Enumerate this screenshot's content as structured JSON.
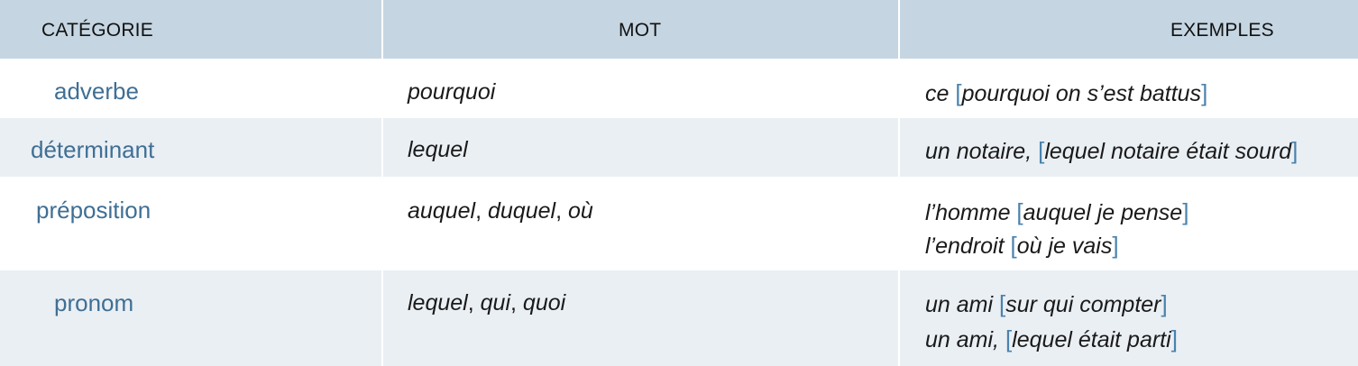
{
  "headers": {
    "categorie": "CATÉGORIE",
    "mot": "MOT",
    "exemples": "EXEMPLES"
  },
  "rows": [
    {
      "categorie": "adverbe",
      "mot": [
        "pourquoi"
      ],
      "exemples": [
        {
          "pre": "ce ",
          "open": "[",
          "inner": "pourquoi on s’est battus",
          "close": "]"
        }
      ]
    },
    {
      "categorie": "déterminant",
      "mot": [
        "lequel"
      ],
      "exemples": [
        {
          "pre": "un notaire, ",
          "open": "[",
          "inner": "lequel notaire était sourd",
          "close": "]"
        }
      ]
    },
    {
      "categorie": "préposition",
      "mot": [
        "auquel",
        "duquel",
        "où"
      ],
      "exemples": [
        {
          "pre": "l’homme ",
          "open": "[",
          "inner": "auquel je pense",
          "close": "]"
        },
        {
          "pre": "l’endroit ",
          "open": "[",
          "inner": "où je vais",
          "close": "]"
        }
      ]
    },
    {
      "categorie": "pronom",
      "mot": [
        "lequel",
        "qui",
        "quoi"
      ],
      "exemples": [
        {
          "pre": "un ami ",
          "open": "[",
          "inner": "sur qui compter",
          "close": "]"
        },
        {
          "pre": "un ami, ",
          "open": "[",
          "inner": "lequel était parti",
          "close": "]"
        }
      ]
    }
  ],
  "separator": ", ",
  "colors": {
    "header_bg": "#c5d5e2",
    "alt_row_bg": "#eaeff4",
    "category_text": "#3f6f94",
    "bracket": "#4a82ad"
  }
}
